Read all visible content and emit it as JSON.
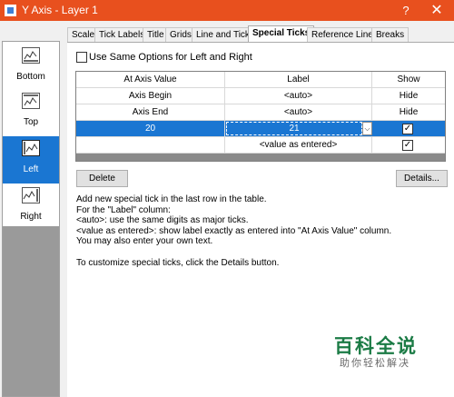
{
  "window": {
    "title": "Y Axis - Layer 1",
    "help_glyph": "?",
    "close_glyph": "✕"
  },
  "sidebar": {
    "items": [
      {
        "label": "Bottom",
        "icon": "axis-plot-icon"
      },
      {
        "label": "Top",
        "icon": "axis-plot-icon"
      },
      {
        "label": "Left",
        "icon": "axis-plot-icon",
        "selected": true
      },
      {
        "label": "Right",
        "icon": "axis-plot-icon"
      }
    ]
  },
  "tabs": [
    "Scale",
    "Tick Labels",
    "Title",
    "Grids",
    "Line and Ticks",
    "Special Ticks",
    "Reference Lines",
    "Breaks"
  ],
  "active_tab": "Special Ticks",
  "same_options": {
    "label": "Use Same Options for Left and Right",
    "checked": false
  },
  "table": {
    "columns": [
      "At Axis Value",
      "Label",
      "Show"
    ],
    "rows": [
      {
        "value": "Axis Begin",
        "label": "<auto>",
        "show": "Hide"
      },
      {
        "value": "Axis End",
        "label": "<auto>",
        "show": "Hide"
      },
      {
        "value": "20",
        "label": "21",
        "show": "✓",
        "selected": true
      },
      {
        "value": "",
        "label": "<value as entered>",
        "show": "✓"
      }
    ],
    "dropdown_glyph": "⌵"
  },
  "buttons": {
    "delete": "Delete",
    "details": "Details..."
  },
  "help_text": "Add new special tick in the last row in the table.\nFor the \"Label\" column:\n<auto>: use the same digits as major ticks.\n<value as entered>: show label exactly as entered into \"At Axis Value\" column.\nYou may also enter your own text.\n\nTo customize special ticks, click the Details button.",
  "watermark": {
    "main": "百科全说",
    "sub": "助你轻松解决"
  }
}
